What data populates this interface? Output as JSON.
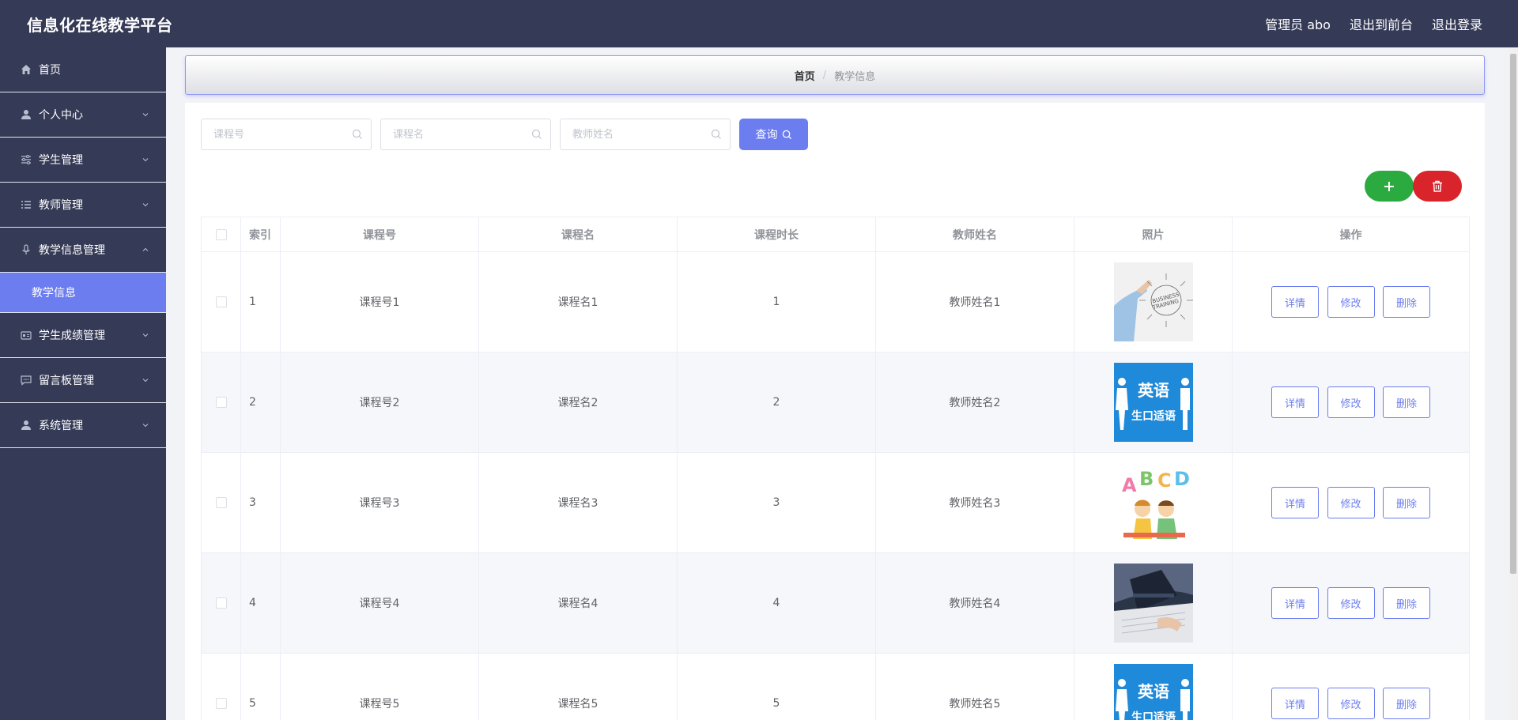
{
  "header": {
    "title": "信息化在线教学平台",
    "admin_label": "管理员 abo",
    "front_label": "退出到前台",
    "logout_label": "退出登录"
  },
  "sidebar": {
    "items": [
      {
        "label": "首页",
        "icon": "home-icon"
      },
      {
        "label": "个人中心",
        "icon": "user-icon"
      },
      {
        "label": "学生管理",
        "icon": "sliders-icon"
      },
      {
        "label": "教师管理",
        "icon": "list-icon"
      },
      {
        "label": "教学信息管理",
        "icon": "microphone-icon"
      },
      {
        "label": "学生成绩管理",
        "icon": "card-icon"
      },
      {
        "label": "留言板管理",
        "icon": "chat-icon"
      },
      {
        "label": "系统管理",
        "icon": "user-icon"
      }
    ],
    "active_sub": "教学信息"
  },
  "breadcrumb": {
    "home": "首页",
    "separator": "/",
    "current": "教学信息"
  },
  "search": {
    "course_no_placeholder": "课程号",
    "course_name_placeholder": "课程名",
    "teacher_placeholder": "教师姓名",
    "query_label": "查询"
  },
  "table": {
    "headers": [
      "索引",
      "课程号",
      "课程名",
      "课程时长",
      "教师姓名",
      "照片",
      "操作"
    ],
    "rows": [
      {
        "index": "1",
        "course_no": "课程号1",
        "course_name": "课程名1",
        "duration": "1",
        "teacher": "教师姓名1",
        "photo": "business-training-photo"
      },
      {
        "index": "2",
        "course_no": "课程号2",
        "course_name": "课程名2",
        "duration": "2",
        "teacher": "教师姓名2",
        "photo": "english-oral-photo"
      },
      {
        "index": "3",
        "course_no": "课程号3",
        "course_name": "课程名3",
        "duration": "3",
        "teacher": "教师姓名3",
        "photo": "abcd-kids-photo"
      },
      {
        "index": "4",
        "course_no": "课程号4",
        "course_name": "课程名4",
        "duration": "4",
        "teacher": "教师姓名4",
        "photo": "student-book-photo"
      },
      {
        "index": "5",
        "course_no": "课程号5",
        "course_name": "课程名5",
        "duration": "5",
        "teacher": "教师姓名5",
        "photo": "english-oral-photo"
      }
    ],
    "actions": {
      "detail": "详情",
      "edit": "修改",
      "delete": "删除"
    }
  },
  "photo_text": {
    "business": "BUSINESS TRAINING",
    "english_top": "英语",
    "english_bottom": "生口适语"
  },
  "colors": {
    "nav_bg": "#353a56",
    "accent": "#6c7df0",
    "add_green": "#2baa3f",
    "delete_red": "#d8242a"
  }
}
